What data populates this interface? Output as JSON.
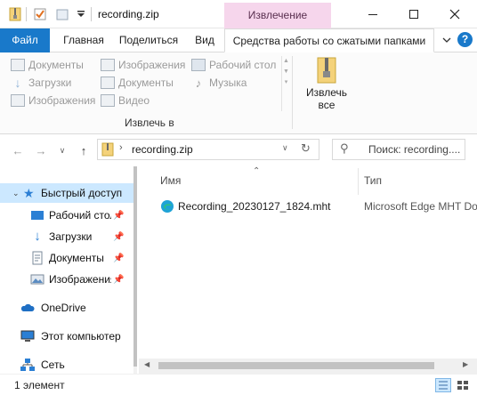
{
  "window": {
    "title": "recording.zip",
    "context_tab": "Извлечение",
    "accent_color": "#1979ca",
    "context_color": "#f6d6ec"
  },
  "ribbon": {
    "tabs": {
      "file": "Файл",
      "home": "Главная",
      "share": "Поделиться",
      "view": "Вид",
      "tools": "Средства работы со сжатыми папками"
    },
    "extract_to_items": [
      {
        "label": "Документы",
        "icon": "folder-documents-icon"
      },
      {
        "label": "Загрузки",
        "icon": "download-arrow-icon"
      },
      {
        "label": "Изображения",
        "icon": "folder-pictures-icon"
      },
      {
        "label": "Изображения",
        "icon": "folder-pictures-icon"
      },
      {
        "label": "Документы",
        "icon": "folder-documents-icon"
      },
      {
        "label": "Видео",
        "icon": "folder-video-icon"
      },
      {
        "label": "Рабочий стол",
        "icon": "desktop-folder-icon"
      },
      {
        "label": "Музыка",
        "icon": "music-note-icon"
      }
    ],
    "group_label": "Извлечь в",
    "extract_all_line1": "Извлечь",
    "extract_all_line2": "все"
  },
  "address": {
    "path": "recording.zip",
    "search_placeholder": "Поиск: recording...."
  },
  "nav": {
    "items": [
      {
        "label": "Быстрый доступ",
        "icon": "star-icon",
        "pinned": false
      },
      {
        "label": "Рабочий стол",
        "icon": "desktop-icon",
        "pinned": true
      },
      {
        "label": "Загрузки",
        "icon": "download-icon",
        "pinned": true
      },
      {
        "label": "Документы",
        "icon": "documents-icon",
        "pinned": true
      },
      {
        "label": "Изображения",
        "icon": "pictures-icon",
        "pinned": true
      },
      {
        "label": "OneDrive",
        "icon": "cloud-icon",
        "pinned": false
      },
      {
        "label": "Этот компьютер",
        "icon": "computer-icon",
        "pinned": false
      },
      {
        "label": "Сеть",
        "icon": "network-icon",
        "pinned": false
      }
    ]
  },
  "files": {
    "columns": {
      "name": "Имя",
      "type": "Тип"
    },
    "rows": [
      {
        "name": "Recording_20230127_1824.mht",
        "type": "Microsoft Edge MHT Do"
      }
    ]
  },
  "status": {
    "count": "1 элемент"
  }
}
